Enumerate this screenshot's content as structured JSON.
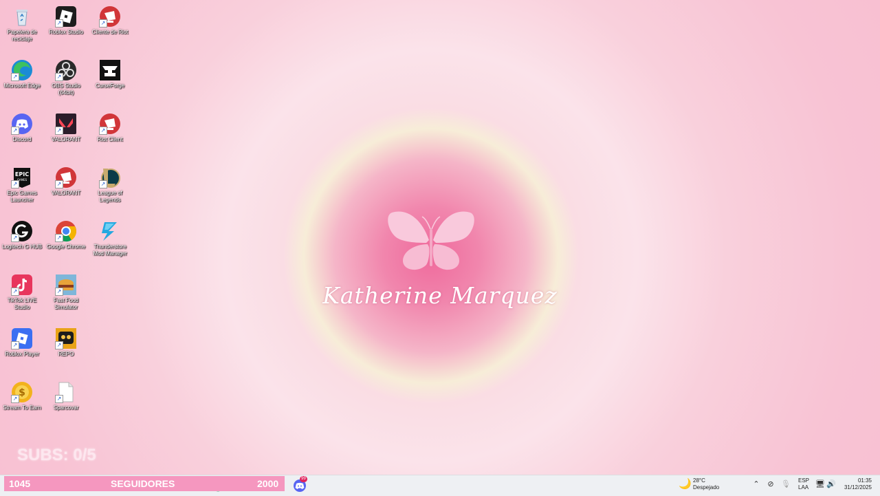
{
  "desktop": {
    "icons": [
      {
        "label": "Papelera de reciclaje",
        "icon": "recycle-bin-icon"
      },
      {
        "label": "Roblox Studio",
        "icon": "roblox-studio-icon"
      },
      {
        "label": "Cliente de Riot",
        "icon": "riot-client-icon"
      },
      {
        "label": "Microsoft Edge",
        "icon": "edge-icon"
      },
      {
        "label": "OBS Studio (64bit)",
        "icon": "obs-icon"
      },
      {
        "label": "CurseForge",
        "icon": "curseforge-icon"
      },
      {
        "label": "Discord",
        "icon": "discord-icon"
      },
      {
        "label": "VALORANT",
        "icon": "valorant-icon"
      },
      {
        "label": "Riot Client",
        "icon": "riot-client-icon"
      },
      {
        "label": "Epic Games Launcher",
        "icon": "epic-games-icon"
      },
      {
        "label": "VALORANT",
        "icon": "riot-client-icon"
      },
      {
        "label": "League of Legends",
        "icon": "league-of-legends-icon"
      },
      {
        "label": "Logitech G HUB",
        "icon": "logitech-icon"
      },
      {
        "label": "Google Chrome",
        "icon": "chrome-icon"
      },
      {
        "label": "Thunderstore Mod Manager",
        "icon": "thunderstore-icon"
      },
      {
        "label": "TikTok LIVE Studio",
        "icon": "tiktok-icon"
      },
      {
        "label": "Fast Food Simulator",
        "icon": "fast-food-simulator-icon"
      },
      {
        "label": "Roblox Player",
        "icon": "roblox-player-icon"
      },
      {
        "label": "REPO",
        "icon": "repo-icon"
      },
      {
        "label": "Stream To Earn",
        "icon": "stream-to-earn-icon"
      },
      {
        "label": "Sparcovar",
        "icon": "blank-file-icon"
      }
    ],
    "wallpaper": {
      "signature": "Katherine Marquez",
      "accent": "#ef6a9c"
    }
  },
  "overlay": {
    "subs_text": "SUBS: 0/5",
    "followers_count": "1045",
    "followers_label": "SEGUIDORES",
    "followers_goal": "2000"
  },
  "taskbar": {
    "apps": [
      "file-explorer-icon",
      "edge-icon",
      "chrome-icon",
      "spotify-icon",
      "obs-icon",
      "discord-icon"
    ],
    "discord_badge": "99",
    "weather": {
      "temp": "28°C",
      "condition": "Despejado",
      "icon": "moon-icon"
    },
    "language": {
      "lang": "ESP",
      "layout": "LAA"
    },
    "clock": {
      "time": "01:35",
      "date": "31/12/2025"
    }
  }
}
